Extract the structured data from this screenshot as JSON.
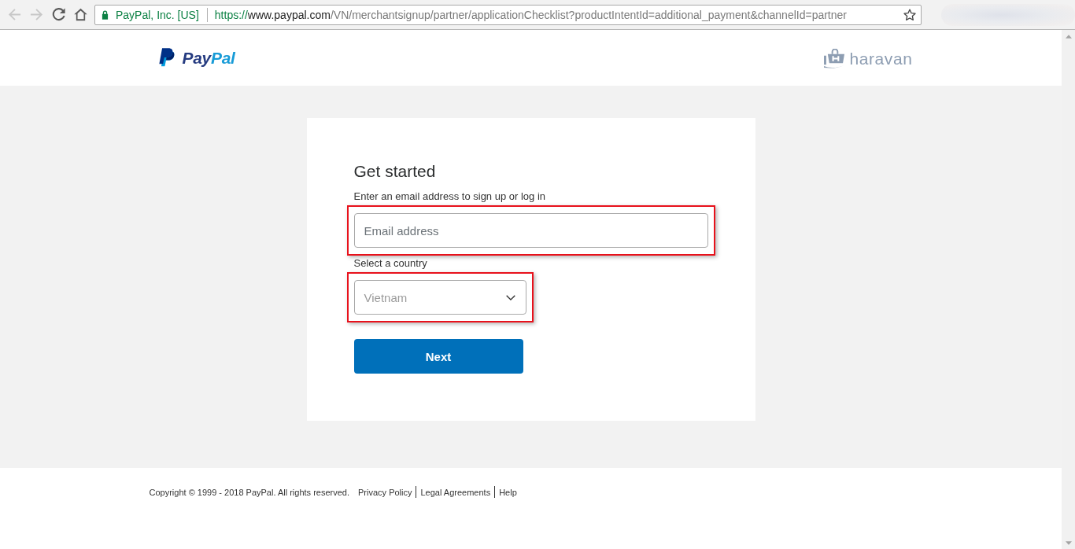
{
  "browser": {
    "nav_buttons": [
      {
        "kind": "back",
        "disabled": true
      },
      {
        "kind": "forward",
        "disabled": true
      },
      {
        "kind": "reload",
        "disabled": false
      },
      {
        "kind": "home",
        "disabled": false
      }
    ],
    "site_identity": "PayPal, Inc. [US]",
    "url": {
      "scheme": "https://",
      "host": "www.paypal.com",
      "path": "/VN/merchantsignup/partner/applicationChecklist?productIntentId=additional_payment&channelId=partner"
    }
  },
  "header": {
    "logo": {
      "parts": [
        "Pay",
        "Pal"
      ]
    },
    "partner_logo": "haravan"
  },
  "form": {
    "title": "Get started",
    "email": {
      "label": "Enter an email address to sign up or log in",
      "placeholder": "Email address",
      "highlighted": true
    },
    "country": {
      "label": "Select a country",
      "value": "Vietnam",
      "disabled": true,
      "highlighted": true
    },
    "submit": "Next"
  },
  "footer": {
    "copyright": "Copyright © 1999 - 2018 PayPal. All rights reserved.",
    "links": [
      "Privacy Policy",
      "Legal Agreements",
      "Help"
    ]
  }
}
